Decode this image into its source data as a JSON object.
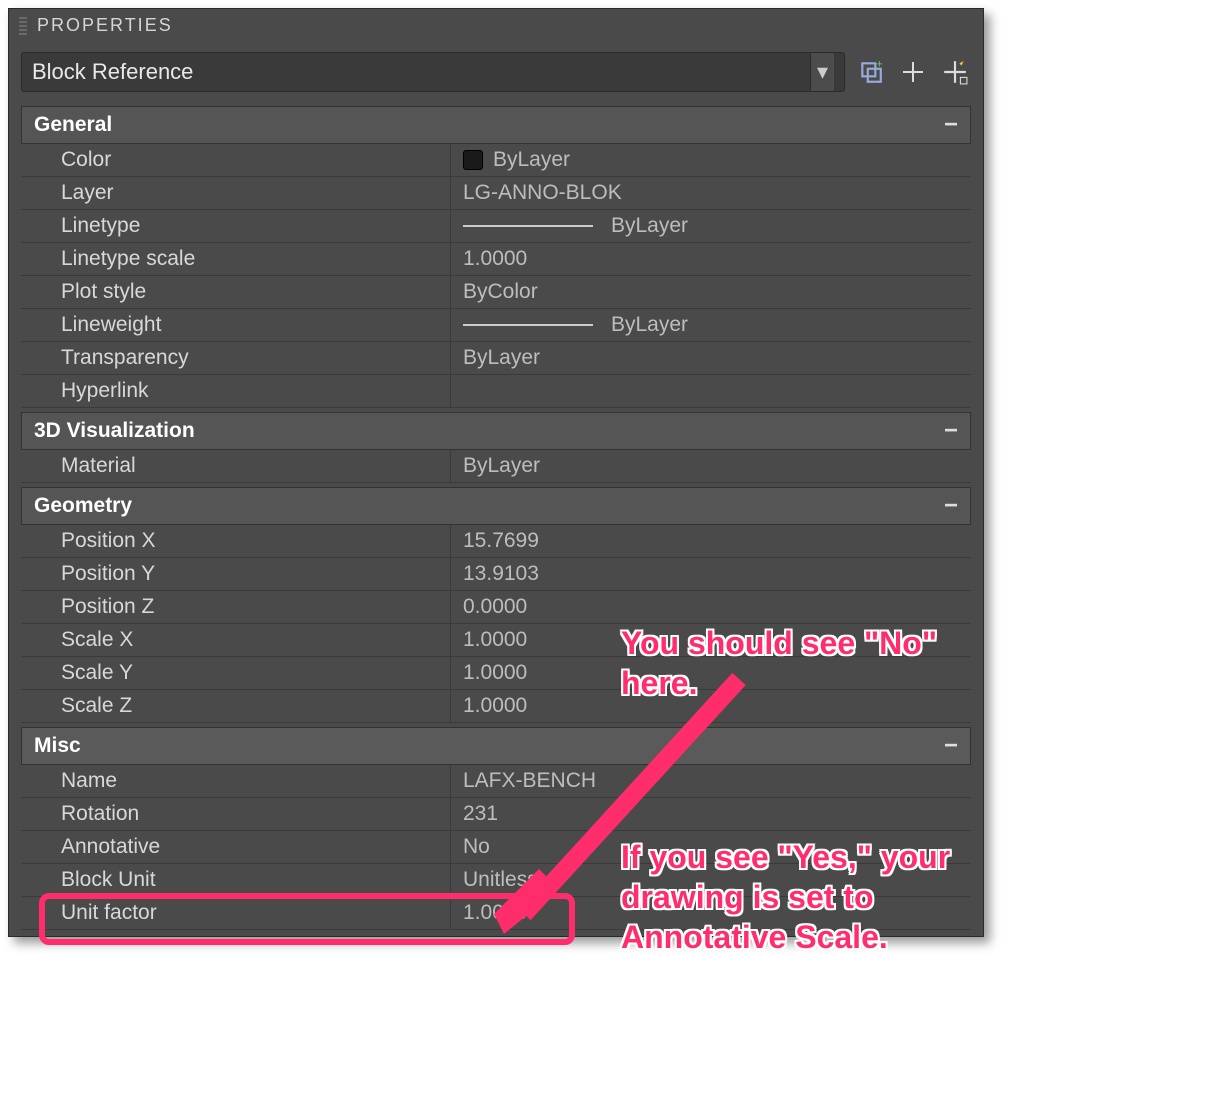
{
  "panel": {
    "title": "PROPERTIES",
    "selector": "Block Reference"
  },
  "sections": {
    "general": {
      "title": "General",
      "color_label": "Color",
      "color_value": "ByLayer",
      "layer_label": "Layer",
      "layer_value": "LG-ANNO-BLOK",
      "linetype_label": "Linetype",
      "linetype_value": "ByLayer",
      "linetype_scale_label": "Linetype scale",
      "linetype_scale_value": "1.0000",
      "plot_style_label": "Plot style",
      "plot_style_value": "ByColor",
      "lineweight_label": "Lineweight",
      "lineweight_value": "ByLayer",
      "transparency_label": "Transparency",
      "transparency_value": "ByLayer",
      "hyperlink_label": "Hyperlink",
      "hyperlink_value": ""
    },
    "viz": {
      "title": "3D Visualization",
      "material_label": "Material",
      "material_value": "ByLayer"
    },
    "geometry": {
      "title": "Geometry",
      "posx_label": "Position X",
      "posx_value": "15.7699",
      "posy_label": "Position Y",
      "posy_value": "13.9103",
      "posz_label": "Position Z",
      "posz_value": "0.0000",
      "sx_label": "Scale X",
      "sx_value": "1.0000",
      "sy_label": "Scale Y",
      "sy_value": "1.0000",
      "sz_label": "Scale Z",
      "sz_value": "1.0000"
    },
    "misc": {
      "title": "Misc",
      "name_label": "Name",
      "name_value": "LAFX-BENCH",
      "rotation_label": "Rotation",
      "rotation_value": "231",
      "annotative_label": "Annotative",
      "annotative_value": "No",
      "block_unit_label": "Block Unit",
      "block_unit_value": "Unitless",
      "unit_factor_label": "Unit factor",
      "unit_factor_value": "1.0000"
    }
  },
  "annotations": {
    "a1": "You should see \"No\" here.",
    "a2": "If you see \"Yes,\" your drawing is set to Annotative Scale."
  }
}
